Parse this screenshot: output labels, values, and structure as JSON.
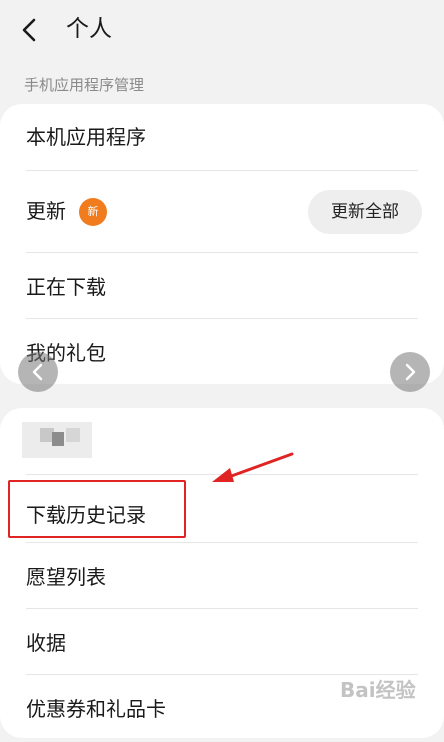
{
  "header": {
    "title": "个人"
  },
  "section": {
    "label": "手机应用程序管理"
  },
  "card1": {
    "items": [
      "本机应用程序",
      "更新",
      "正在下载",
      "我的礼包"
    ],
    "new_badge": "新",
    "update_all": "更新全部"
  },
  "card2": {
    "items": [
      "下载历史记录",
      "愿望列表",
      "收据",
      "优惠券和礼品卡"
    ]
  },
  "watermark": {
    "text": "Bai经验"
  },
  "colors": {
    "badge": "#f07c1e",
    "annotation": "#e02424"
  },
  "icons": {
    "back": "chevron-left-icon",
    "nav_left": "chevron-left-icon",
    "nav_right": "chevron-right-icon"
  }
}
